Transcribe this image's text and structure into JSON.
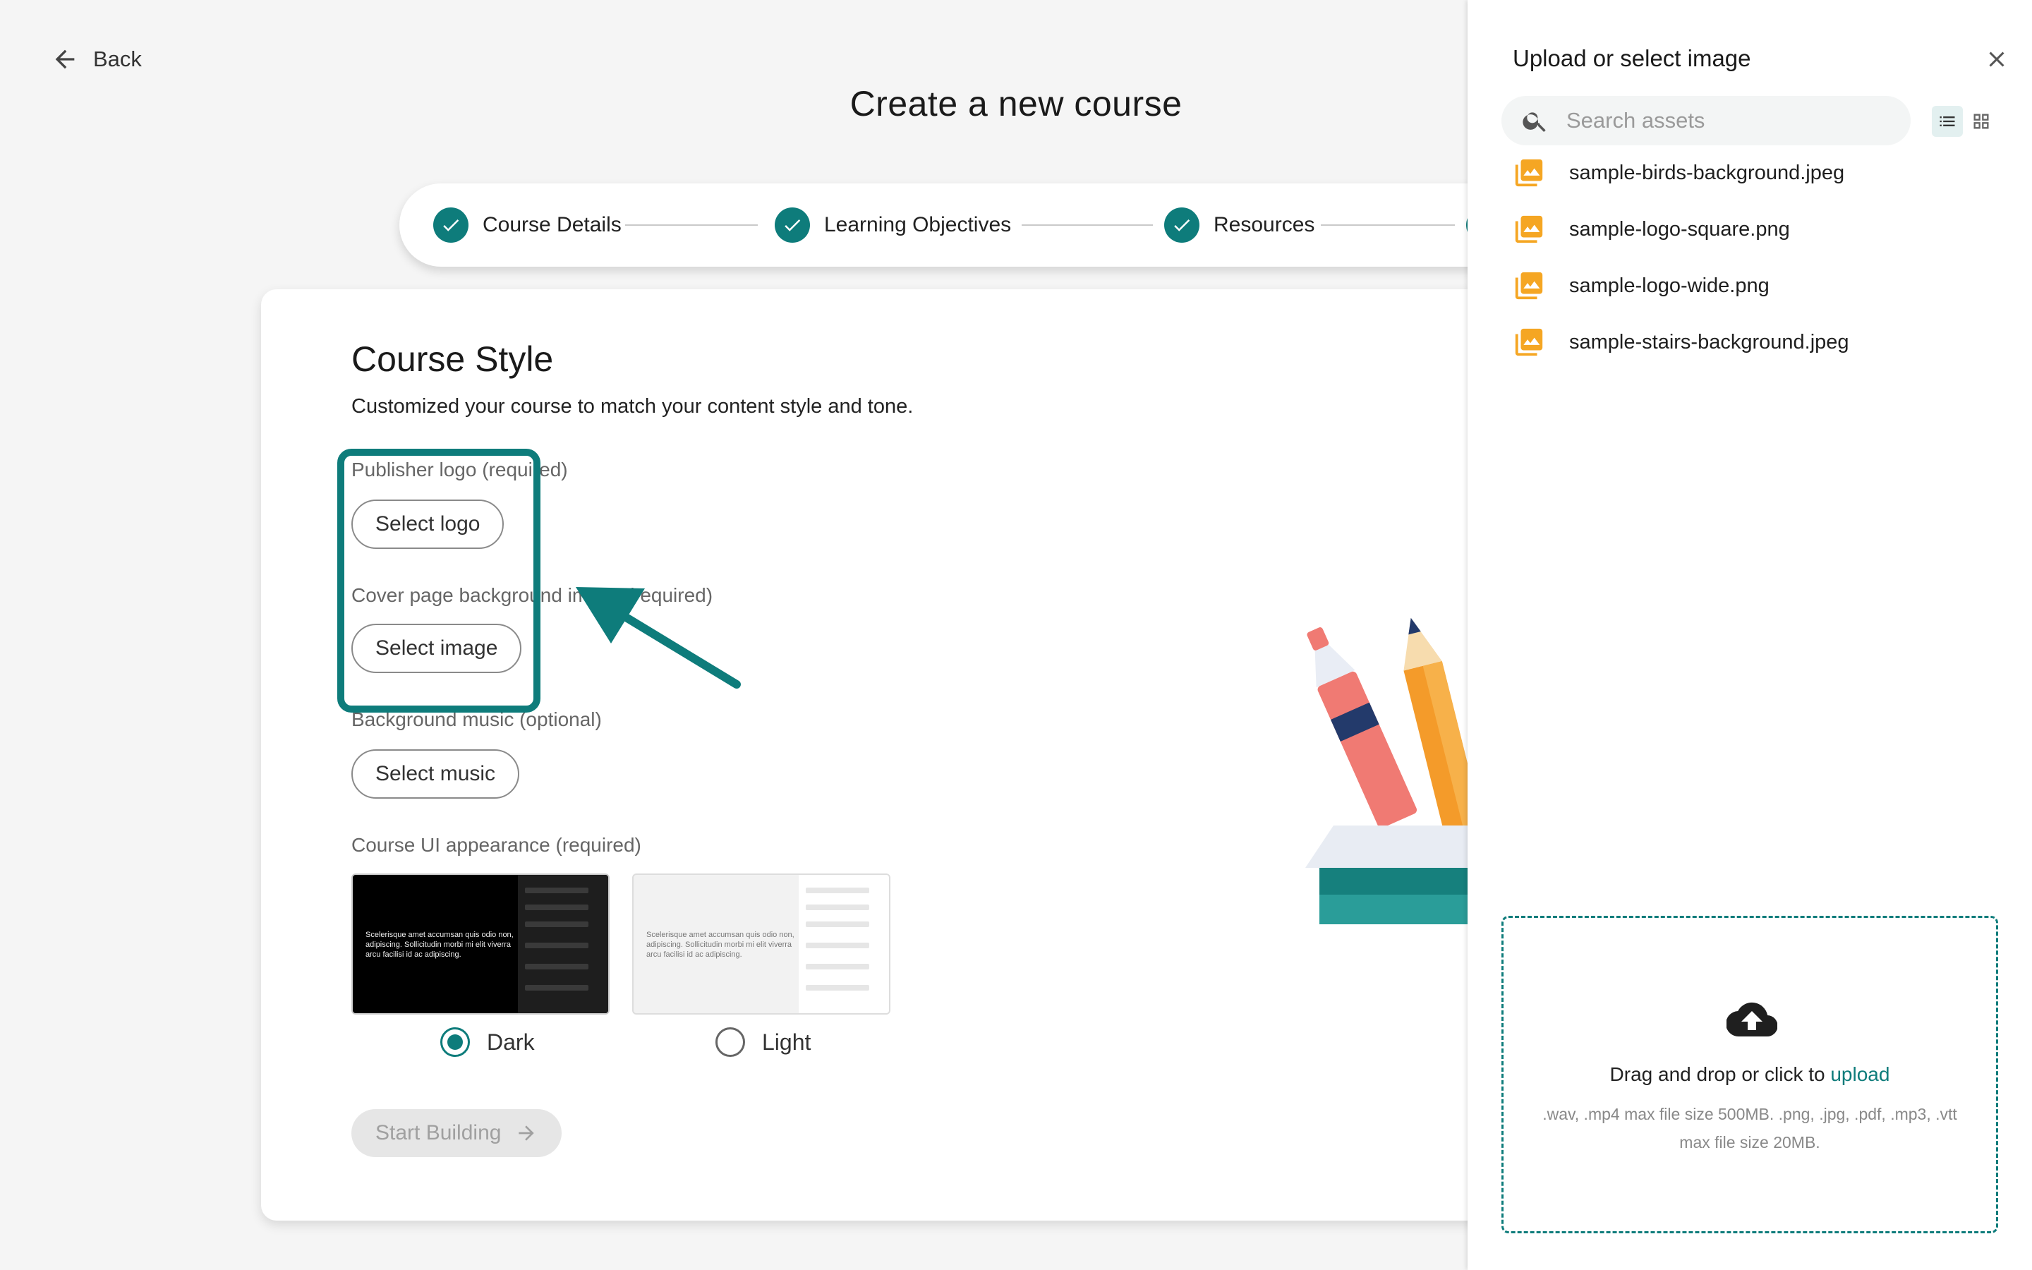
{
  "nav": {
    "back_label": "Back"
  },
  "page": {
    "title": "Create a new course"
  },
  "stepper": {
    "steps": [
      {
        "label": "Course Details"
      },
      {
        "label": "Learning Objectives"
      },
      {
        "label": "Resources"
      }
    ]
  },
  "course_style": {
    "title": "Course Style",
    "subtitle": "Customized your course to match your content style and tone.",
    "publisher_logo_label": "Publisher logo (required)",
    "select_logo_label": "Select logo",
    "cover_label": "Cover page background image (required)",
    "select_image_label": "Select image",
    "music_label": "Background music (optional)",
    "select_music_label": "Select music",
    "appearance_label": "Course UI appearance (required)",
    "themes": [
      {
        "label": "Dark",
        "selected": true,
        "sample_text": "Scelerisque amet accumsan quis odio non, adipiscing. Sollicitudin morbi mi elit viverra arcu facilisi id ac adipiscing."
      },
      {
        "label": "Light",
        "selected": false,
        "sample_text": "Scelerisque amet accumsan quis odio non, adipiscing. Sollicitudin morbi mi elit viverra arcu facilisi id ac adipiscing."
      }
    ],
    "start_label": "Start Building"
  },
  "drawer": {
    "title": "Upload or select image",
    "search_placeholder": "Search assets",
    "files": [
      {
        "name": "sample-birds-background.jpeg"
      },
      {
        "name": "sample-logo-square.png"
      },
      {
        "name": "sample-logo-wide.png"
      },
      {
        "name": "sample-stairs-background.jpeg"
      }
    ],
    "dropzone": {
      "text": "Drag and drop or click to ",
      "link": "upload",
      "hint": ".wav, .mp4 max file size 500MB. .png, .jpg, .pdf, .mp3, .vtt max file size 20MB."
    }
  },
  "colors": {
    "accent": "#0e7c7b",
    "file_icon": "#f5a623"
  },
  "icons": [
    "back-arrow-icon",
    "check-icon",
    "search-icon",
    "close-icon",
    "list-view-icon",
    "grid-view-icon",
    "image-file-icon",
    "cloud-upload-icon",
    "arrow-right-icon"
  ]
}
